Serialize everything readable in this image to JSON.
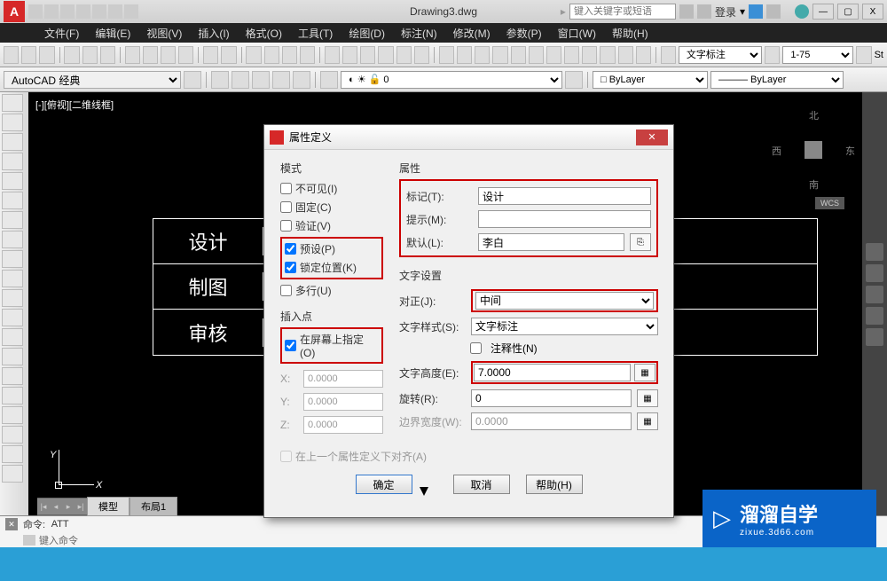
{
  "title_bar": {
    "app_letter": "A",
    "filename": "Drawing3.dwg",
    "search_placeholder": "键入关键字或短语",
    "login": "登录",
    "x_icon": "X"
  },
  "menus": [
    "文件(F)",
    "编辑(E)",
    "视图(V)",
    "插入(I)",
    "格式(O)",
    "工具(T)",
    "绘图(D)",
    "标注(N)",
    "修改(M)",
    "参数(P)",
    "窗口(W)",
    "帮助(H)"
  ],
  "toolbar1": {
    "textstyle": "文字标注",
    "dimscale": "1-75",
    "st_label": "St"
  },
  "toolbar2": {
    "workspace": "AutoCAD 经典",
    "layer0": "0",
    "bylayer1": "ByLayer",
    "bylayer2": "ByLayer"
  },
  "viewport_label": "[-][俯视][二维线框]",
  "compass": {
    "n": "北",
    "s": "南",
    "e": "东",
    "w": "西"
  },
  "wcs": "WCS",
  "table_rows": [
    "设计",
    "制图",
    "审核"
  ],
  "model_tabs": {
    "model": "模型",
    "layout1": "布局1"
  },
  "ucs": {
    "x": "X",
    "y": "Y"
  },
  "dialog": {
    "title": "属性定义",
    "mode_label": "模式",
    "modes": {
      "invisible": "不可见(I)",
      "constant": "固定(C)",
      "verify": "验证(V)",
      "preset": "预设(P)",
      "lock": "锁定位置(K)",
      "multiline": "多行(U)"
    },
    "insertion_label": "插入点",
    "onscreen": "在屏幕上指定(O)",
    "coords": {
      "x": "X:",
      "y": "Y:",
      "z": "Z:",
      "val": "0.0000"
    },
    "attr_label": "属性",
    "attr": {
      "tag_label": "标记(T):",
      "tag_val": "设计",
      "prompt_label": "提示(M):",
      "prompt_val": "",
      "default_label": "默认(L):",
      "default_val": "李白"
    },
    "text_label": "文字设置",
    "text": {
      "justify_label": "对正(J):",
      "justify_val": "中间",
      "style_label": "文字样式(S):",
      "style_val": "文字标注",
      "annotative": "注释性(N)",
      "height_label": "文字高度(E):",
      "height_val": "7.0000",
      "rotation_label": "旋转(R):",
      "rotation_val": "0",
      "bwidth_label": "边界宽度(W):",
      "bwidth_val": "0.0000"
    },
    "align_prev": "在上一个属性定义下对齐(A)",
    "btn_ok": "确定",
    "btn_cancel": "取消",
    "btn_help": "帮助(H)"
  },
  "cmd": {
    "prefix": "命令:",
    "text": "ATT",
    "hint": "键入命令"
  },
  "watermark": {
    "logo": "▷",
    "line1": "溜溜自学",
    "line2": "zixue.3d66.com"
  }
}
